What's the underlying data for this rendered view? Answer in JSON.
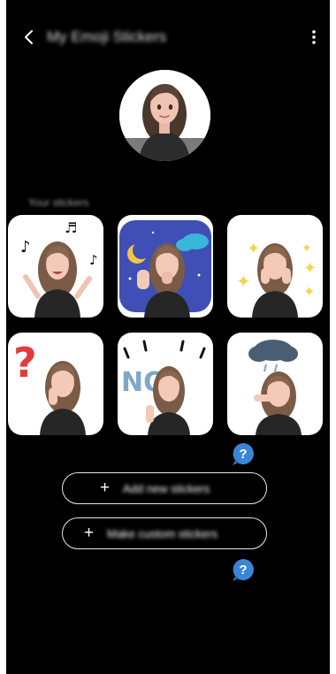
{
  "app_bar": {
    "title": "My Emoji Stickers",
    "back_icon": "chevron-left-icon",
    "more_icon": "more-vertical-icon"
  },
  "section": {
    "label": "Your stickers"
  },
  "stickers": [
    {
      "id": "music",
      "emojis": [
        "♪",
        "♬",
        "♪"
      ]
    },
    {
      "id": "night",
      "emojis": []
    },
    {
      "id": "sparkles",
      "emojis": [
        "✦",
        "✦",
        "✦",
        "✦",
        "✦"
      ]
    },
    {
      "id": "question",
      "emojis": [
        "?"
      ]
    },
    {
      "id": "no",
      "text": "NO"
    },
    {
      "id": "cloud",
      "emojis": []
    }
  ],
  "buttons": {
    "add_label": "Add new stickers",
    "custom_label": "Make custom stickers",
    "plus_glyph": "+"
  },
  "help": {
    "glyph": "?"
  },
  "colors": {
    "background": "#000000",
    "card": "#ffffff",
    "help_badge": "#3a86d6",
    "button_border": "#e8e8e8"
  }
}
